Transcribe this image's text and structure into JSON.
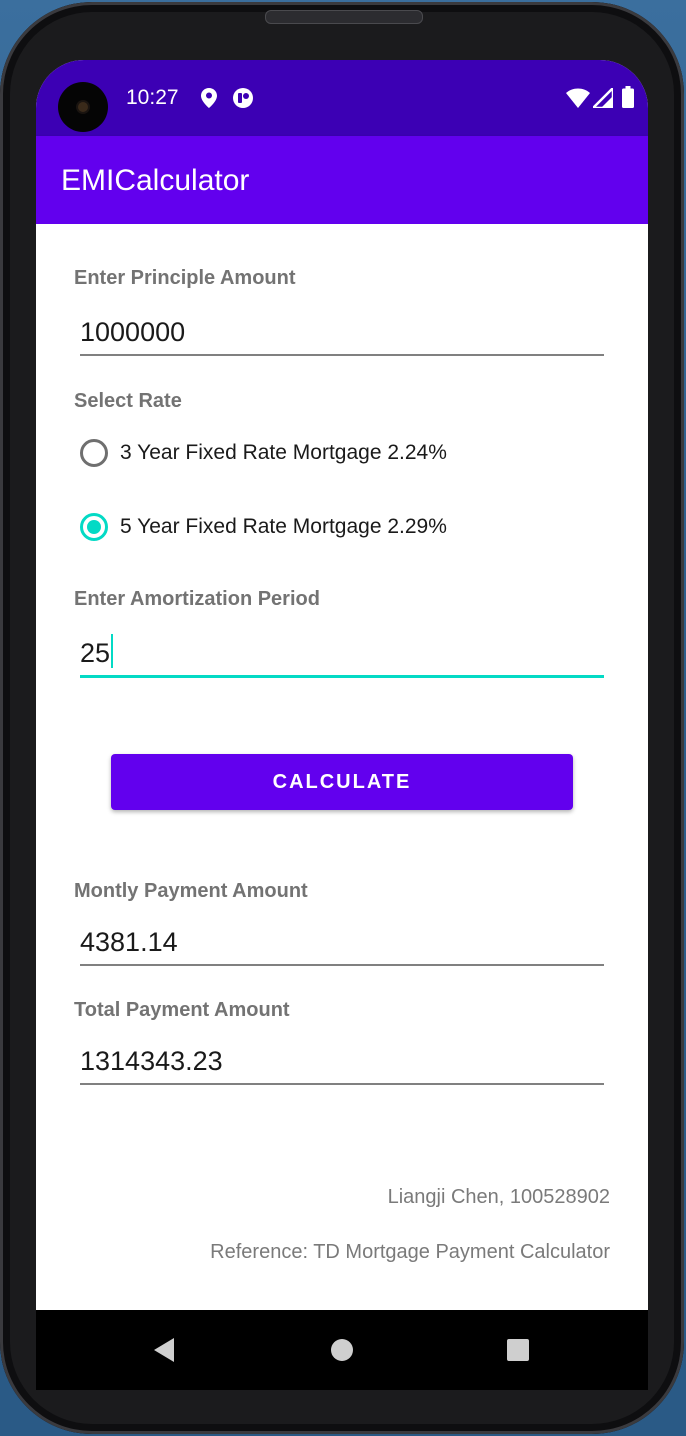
{
  "status_bar": {
    "time": "10:27",
    "icons": [
      "location-icon",
      "notification-icon",
      "wifi-icon",
      "signal-icon",
      "battery-icon"
    ]
  },
  "app_bar": {
    "title": "EMICalculator"
  },
  "form": {
    "principal_label": "Enter Principle Amount",
    "principal_value": "1000000",
    "rate_label": "Select Rate",
    "rate_options": [
      {
        "label": "3 Year Fixed Rate Mortgage 2.24%",
        "checked": false
      },
      {
        "label": "5 Year Fixed Rate Mortgage 2.29%",
        "checked": true
      }
    ],
    "amortization_label": "Enter Amortization Period",
    "amortization_value": "25",
    "calculate_label": "CALCULATE"
  },
  "results": {
    "monthly_label": "Montly Payment Amount",
    "monthly_value": "4381.14",
    "total_label": "Total Payment Amount",
    "total_value": "1314343.23"
  },
  "footer": {
    "author": "Liangji Chen, 100528902",
    "reference": "Reference: TD Mortgage Payment Calculator"
  },
  "navigation": {
    "buttons": [
      "back-icon",
      "home-icon",
      "recents-icon"
    ]
  },
  "colors": {
    "status_bar": "#3c00b4",
    "primary": "#6200ee",
    "accent": "#03dac5"
  }
}
